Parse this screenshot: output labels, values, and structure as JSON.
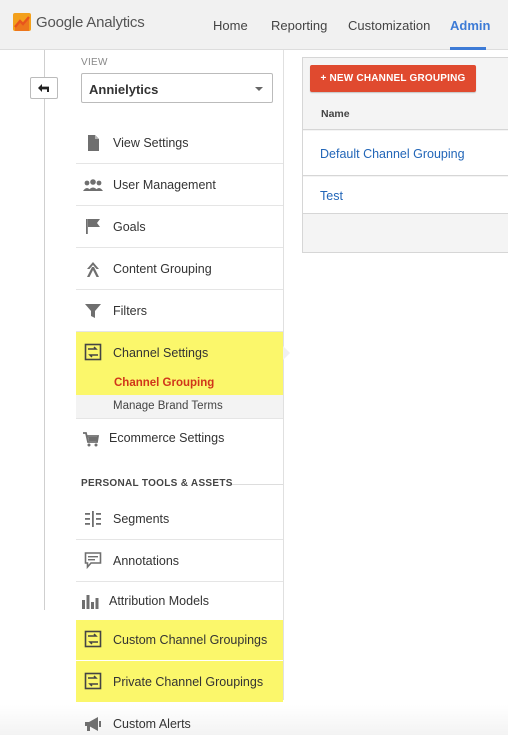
{
  "header": {
    "app_title": "Google Analytics",
    "nav": [
      {
        "label": "Home"
      },
      {
        "label": "Reporting"
      },
      {
        "label": "Customization"
      },
      {
        "label": "Admin"
      }
    ],
    "active_nav": "Admin",
    "accent_color": "#3d7bd6"
  },
  "view": {
    "label": "VIEW",
    "selected": "Annielytics"
  },
  "menu": {
    "items": [
      {
        "label": "View Settings",
        "icon": "document-icon"
      },
      {
        "label": "User Management",
        "icon": "users-icon"
      },
      {
        "label": "Goals",
        "icon": "flag-icon"
      },
      {
        "label": "Content Grouping",
        "icon": "content-grouping-icon"
      },
      {
        "label": "Filters",
        "icon": "filter-icon"
      },
      {
        "label": "Channel Settings",
        "icon": "channel-icon",
        "highlighted": true
      },
      {
        "label": "Ecommerce Settings",
        "icon": "cart-icon"
      }
    ],
    "channel_sub": {
      "active": "Channel Grouping",
      "other": "Manage Brand Terms"
    },
    "section_heading": "PERSONAL TOOLS & ASSETS",
    "personal_items": [
      {
        "label": "Segments",
        "icon": "segments-icon"
      },
      {
        "label": "Annotations",
        "icon": "annotation-icon"
      },
      {
        "label": "Attribution Models",
        "icon": "bar-chart-icon"
      },
      {
        "label": "Custom Channel Groupings",
        "icon": "channel-icon",
        "highlighted": true
      },
      {
        "label": "Private Channel Groupings",
        "icon": "channel-icon",
        "highlighted": true
      },
      {
        "label": "Custom Alerts",
        "icon": "megaphone-icon"
      }
    ],
    "highlight_color": "#fbf76b",
    "active_sub_color": "#d0361a"
  },
  "panel": {
    "new_button": "+ NEW CHANNEL GROUPING",
    "column_name": "Name",
    "rows": [
      {
        "name": "Default Channel Grouping"
      },
      {
        "name": "Test"
      }
    ],
    "button_color": "#e04a2f",
    "link_color": "#2266b8"
  }
}
